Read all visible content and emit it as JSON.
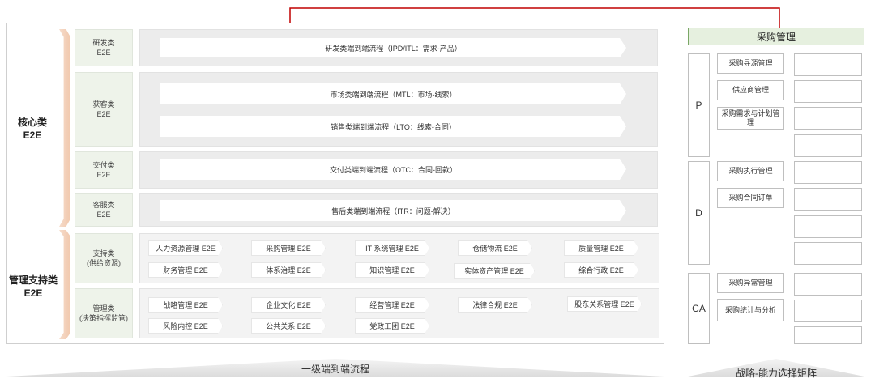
{
  "left": {
    "groups": [
      {
        "label": "核心类\nE2E"
      },
      {
        "label": "管理支持类\nE2E"
      }
    ],
    "categories": [
      {
        "label": "研发类\nE2E"
      },
      {
        "label": "获客类\nE2E"
      },
      {
        "label": "交付类\nE2E"
      },
      {
        "label": "客服类\nE2E"
      },
      {
        "label": "支持类\n(供给资源)"
      },
      {
        "label": "管理类\n(决策指挥监管)"
      }
    ],
    "flows": {
      "rd": "研发类端到端流程（IPD/ITL：需求-产品）",
      "mtl": "市场类端到端流程（MTL：市场-线索）",
      "lto": "销售类端到端流程（LTO：线索-合同）",
      "otc": "交付类端到端流程（OTC：合同-回款）",
      "itr": "售后类端到端流程（ITR：问题-解决）"
    },
    "support_items": [
      "人力资源管理 E2E",
      "采购管理 E2E",
      "IT 系统管理 E2E",
      "仓储物流 E2E",
      "质量管理 E2E",
      "财务管理 E2E",
      "体系治理 E2E",
      "知识管理 E2E",
      "实体资产管理 E2E",
      "综合行政 E2E"
    ],
    "mgmt_items": [
      "战略管理 E2E",
      "企业文化 E2E",
      "经营管理 E2E",
      "法律合规 E2E",
      "股东关系管理 E2E",
      "风险内控 E2E",
      "公共关系 E2E",
      "党政工团 E2E"
    ]
  },
  "right": {
    "header": "采购管理",
    "phases": [
      "P",
      "D",
      "CA"
    ],
    "items": {
      "p": [
        "采购寻源管理",
        "供应商管理",
        "采购需求与计划管理"
      ],
      "d": [
        "采购执行管理",
        "采购合同订单"
      ],
      "ca": [
        "采购异常管理",
        "采购统计与分析"
      ]
    }
  },
  "footer": {
    "left": "一级端到端流程",
    "right": "战略-能力选择矩阵"
  },
  "colors": {
    "connector": "#c00000",
    "header_fill": "#e6f0df",
    "header_border": "#7aa766"
  }
}
